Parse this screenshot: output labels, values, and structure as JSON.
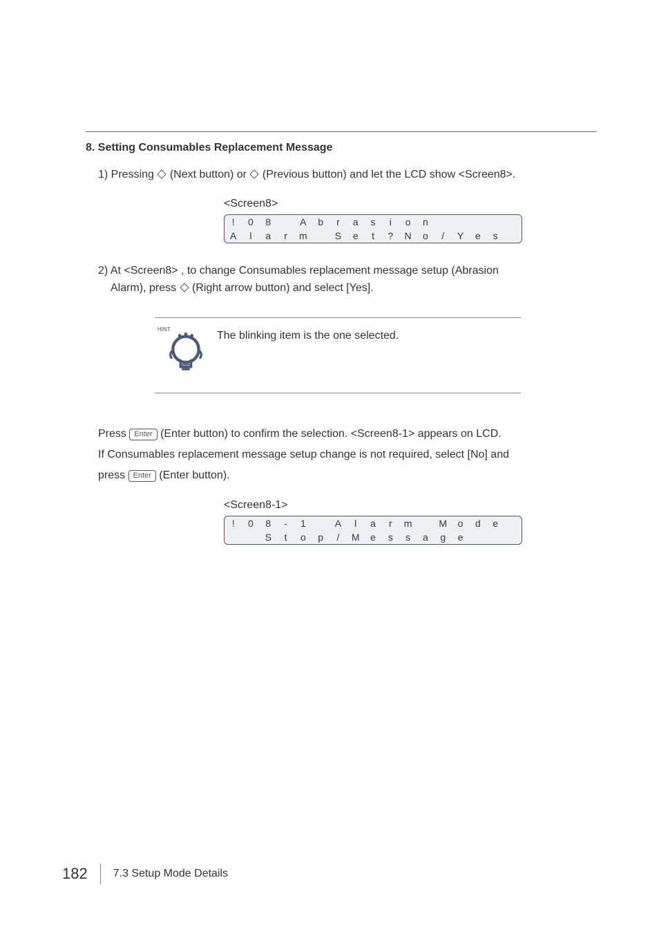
{
  "heading": "8. Setting Consumables Replacement Message",
  "step1_a": "1) Pressing ",
  "step1_b": "(Next button) or ",
  "step1_c": " (Previous button) and let the LCD show <Screen8>.",
  "screen8_caption": "<Screen8>",
  "screen8_row1": [
    "!",
    "0",
    "8",
    "",
    "A",
    "b",
    "r",
    "a",
    "s",
    "i",
    "o",
    "n",
    "",
    "",
    "",
    "",
    ""
  ],
  "screen8_row2": [
    "A",
    "l",
    "a",
    "r",
    "m",
    "",
    "S",
    "e",
    "t",
    "?",
    "N",
    "o",
    "/",
    "Y",
    "e",
    "s",
    ""
  ],
  "step2_a": "2) At <Screen8> , to change Consumables replacement message setup (Abrasion",
  "step2_b": "Alarm), press ",
  "step2_c": "(Right arrow button) and select [Yes].",
  "hint_label": "HINT",
  "hint_text": "The blinking item is the one selected.",
  "para_a": "Press ",
  "para_b": "(Enter button) to confirm the selection. <Screen8-1> appears on LCD.",
  "para_c": "If Consumables replacement message setup change is not required, select [No] and",
  "para_d": "press ",
  "para_e": "(Enter button).",
  "enter_label": "Enter",
  "screen8_1_caption": "<Screen8-1>",
  "screen8_1_row1": [
    "!",
    "0",
    "8",
    "-",
    "1",
    "",
    "A",
    "l",
    "a",
    "r",
    "m",
    "",
    "M",
    "o",
    "d",
    "e",
    ""
  ],
  "screen8_1_row2": [
    "",
    "",
    "S",
    "t",
    "o",
    "p",
    "/",
    "M",
    "e",
    "s",
    "s",
    "a",
    "g",
    "e",
    "",
    "",
    ""
  ],
  "footer_page": "182",
  "footer_text": "7.3  Setup Mode Details"
}
